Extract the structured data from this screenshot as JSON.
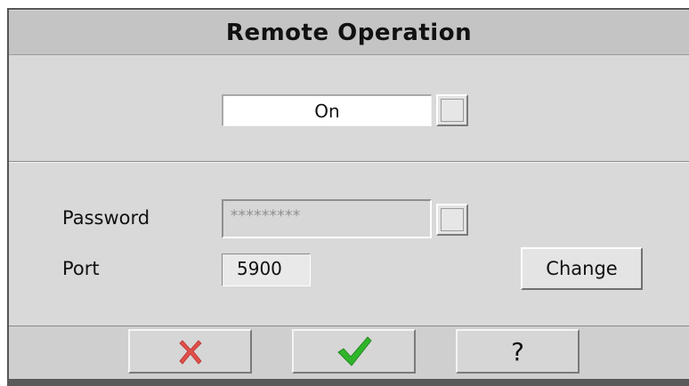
{
  "dialog": {
    "title": "Remote Operation"
  },
  "remote_toggle": {
    "value": "On"
  },
  "settings": {
    "password_label": "Password",
    "password_value": "*********",
    "port_label": "Port",
    "port_value": "5900",
    "change_label": "Change"
  },
  "actions": {
    "cancel_icon": "cancel-x-icon",
    "ok_icon": "checkmark-icon",
    "help_label": "?"
  },
  "colors": {
    "dialog_bg": "#d9d9d9",
    "title_bg": "#c4c4c4",
    "cancel_red": "#e0504a",
    "ok_green": "#2fb52a"
  }
}
